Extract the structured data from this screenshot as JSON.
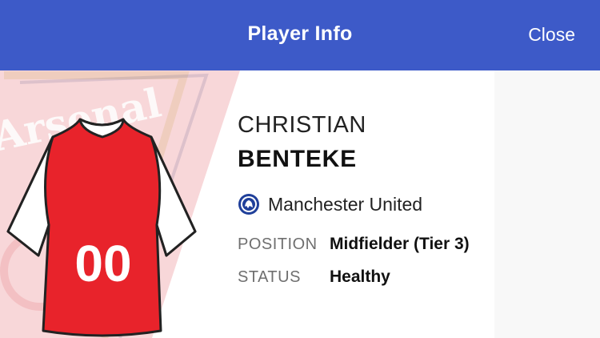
{
  "header": {
    "title": "Player Info",
    "close_label": "Close"
  },
  "background_crest": {
    "text": "Arsenal",
    "icon": "arsenal-crest-icon"
  },
  "jersey": {
    "number": "00",
    "color": "#e8232b",
    "sleeve_color": "#ffffff",
    "icon": "jersey-icon"
  },
  "player": {
    "first_name": "CHRISTIAN",
    "last_name": "BENTEKE",
    "club": "Manchester United",
    "club_badge_icon": "chelsea-badge-icon"
  },
  "details": [
    {
      "label": "POSITION",
      "value": "Midfielder (Tier 3)"
    },
    {
      "label": "STATUS",
      "value": "Healthy"
    }
  ],
  "colors": {
    "header": "#3d5ac8",
    "crest_red": "#d9222b",
    "badge_blue": "#1f3f9a"
  }
}
